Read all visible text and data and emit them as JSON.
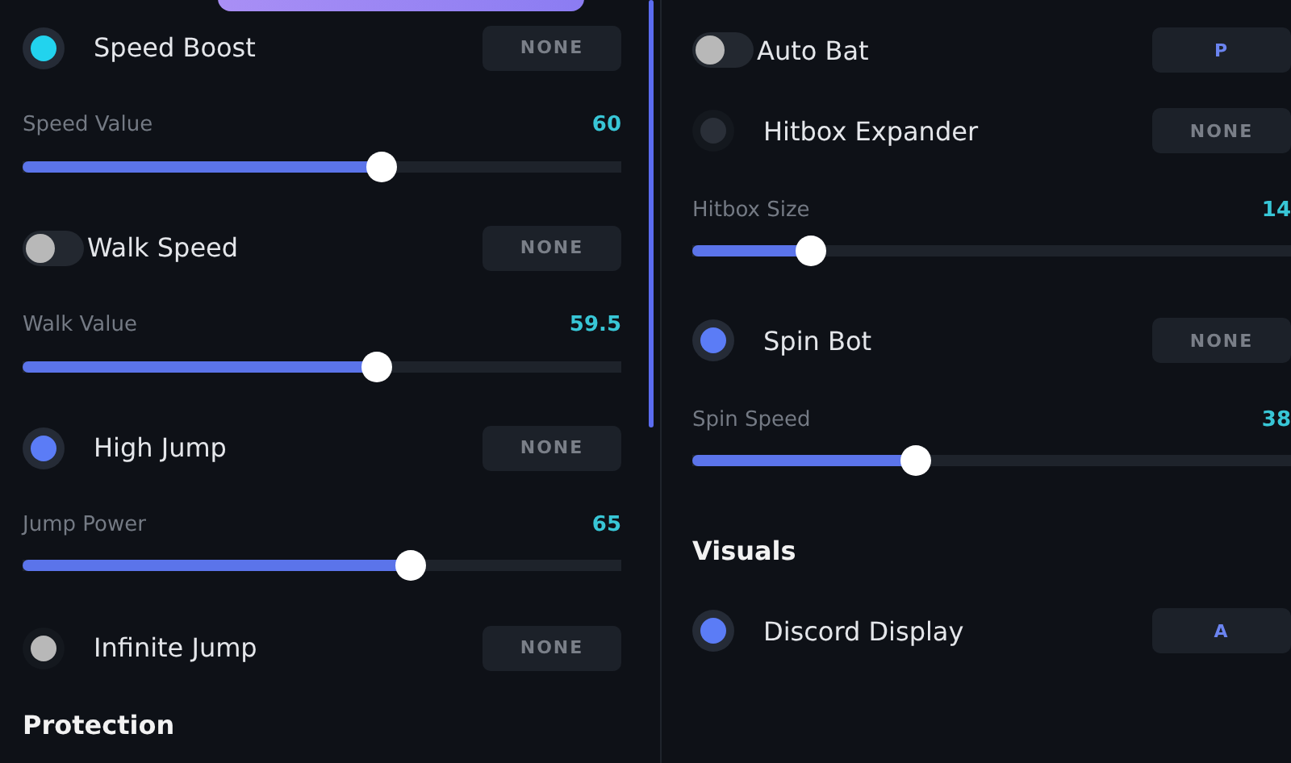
{
  "columns": [
    {
      "items": [
        {
          "kind": "toggle",
          "label": "Speed Boost",
          "toggle": {
            "kind": "dot",
            "on": true,
            "color": "#22d3ee"
          },
          "key": "NONE",
          "bound": false
        },
        {
          "kind": "slider",
          "label": "Speed Value",
          "value": "60",
          "level": 0.6
        },
        {
          "kind": "toggle",
          "label": "Walk Speed",
          "toggle": {
            "kind": "pill",
            "on": false,
            "color": "#b8b8b8"
          },
          "key": "NONE",
          "bound": false
        },
        {
          "kind": "slider",
          "label": "Walk Value",
          "value": "59.5",
          "level": 0.594
        },
        {
          "kind": "toggle",
          "label": "High Jump",
          "toggle": {
            "kind": "dot",
            "on": true,
            "color": "#5b7cf6"
          },
          "key": "NONE",
          "bound": false
        },
        {
          "kind": "slider",
          "label": "Jump Power",
          "value": "65",
          "level": 0.65
        },
        {
          "kind": "toggle",
          "label": "Infinite Jump",
          "toggle": {
            "kind": "dot",
            "on": false,
            "color": "#b8b8b8"
          },
          "key": "NONE",
          "bound": false
        },
        {
          "kind": "heading",
          "label": "Protection"
        }
      ]
    },
    {
      "items": [
        {
          "kind": "toggle",
          "label": "Auto Bat",
          "toggle": {
            "kind": "pill",
            "on": false,
            "color": "#b8b8b8"
          },
          "key": "P",
          "bound": true
        },
        {
          "kind": "toggle",
          "label": "Hitbox Expander",
          "toggle": {
            "kind": "dot",
            "on": false,
            "color": "#2a2f38"
          },
          "key": "NONE",
          "bound": false
        },
        {
          "kind": "slider",
          "label": "Hitbox Size",
          "value": "14",
          "level": 0.2
        },
        {
          "kind": "toggle",
          "label": "Spin Bot",
          "toggle": {
            "kind": "dot",
            "on": true,
            "color": "#5b7cf6"
          },
          "key": "NONE",
          "bound": false
        },
        {
          "kind": "slider",
          "label": "Spin Speed",
          "value": "38",
          "level": 0.375
        },
        {
          "kind": "heading",
          "label": "Visuals"
        },
        {
          "kind": "toggle",
          "label": "Discord Display",
          "toggle": {
            "kind": "dot",
            "on": true,
            "color": "#5b7cf6"
          },
          "key": "A",
          "bound": true
        }
      ]
    }
  ]
}
